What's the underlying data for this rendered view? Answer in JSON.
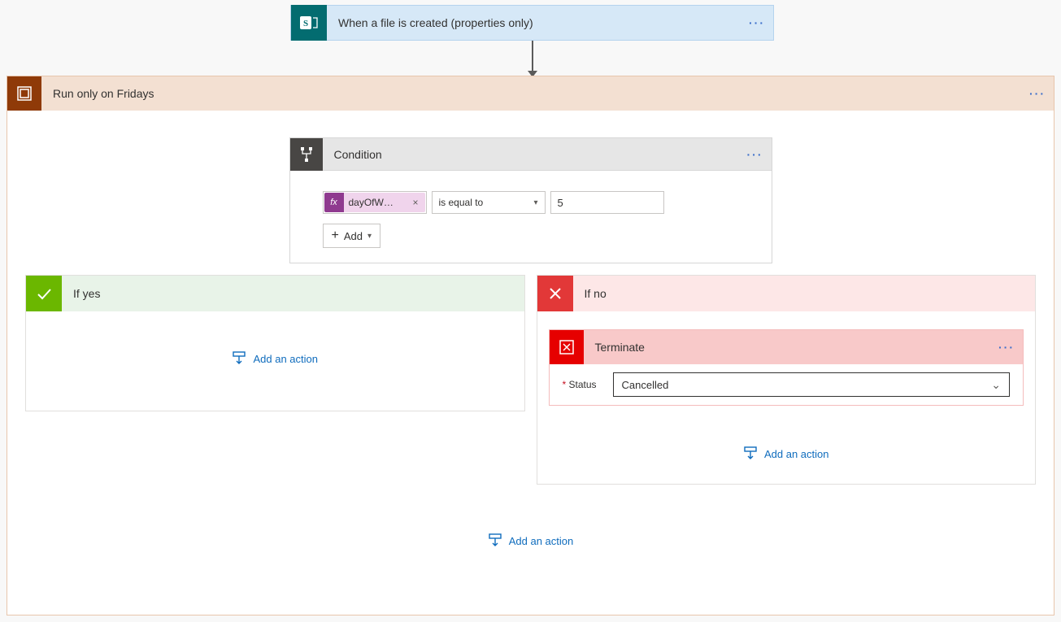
{
  "trigger": {
    "title": "When a file is created (properties only)"
  },
  "scope": {
    "title": "Run only on Fridays"
  },
  "condition": {
    "title": "Condition",
    "expression": "dayOfW…",
    "operator": "is equal to",
    "value": "5",
    "remove": "×",
    "add_label": "Add"
  },
  "branches": {
    "yes_label": "If yes",
    "no_label": "If no",
    "add_action_label": "Add an action"
  },
  "terminate": {
    "title": "Terminate",
    "status_label": "Status",
    "status_value": "Cancelled",
    "required": "*"
  }
}
